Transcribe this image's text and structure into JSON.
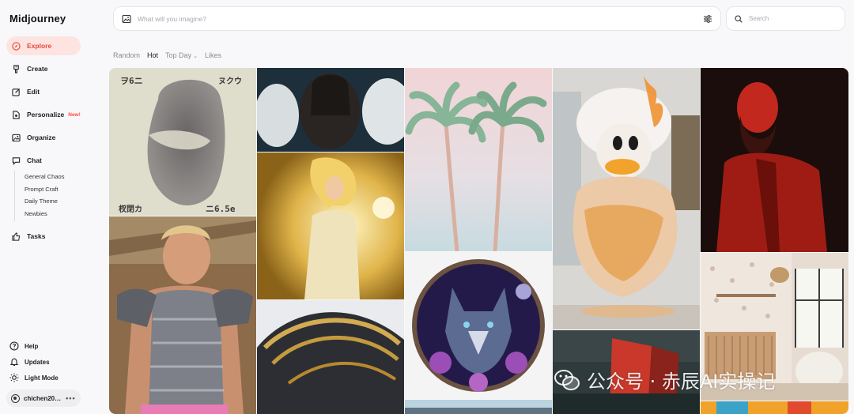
{
  "app": {
    "title": "Midjourney"
  },
  "sidebar": {
    "items": [
      {
        "label": "Explore",
        "icon": "compass-icon"
      },
      {
        "label": "Create",
        "icon": "brush-icon"
      },
      {
        "label": "Edit",
        "icon": "edit-icon"
      },
      {
        "label": "Personalize",
        "icon": "personalize-icon",
        "badge": "New!"
      },
      {
        "label": "Organize",
        "icon": "image-icon"
      },
      {
        "label": "Chat",
        "icon": "chat-icon"
      }
    ],
    "chat_rooms": [
      "General Chaos",
      "Prompt Craft",
      "Daily Theme",
      "Newbies"
    ],
    "tasks_label": "Tasks",
    "bottom": {
      "help": "Help",
      "updates": "Updates",
      "light_mode": "Light Mode"
    },
    "user": {
      "name": "chichen20…",
      "more": "•••"
    }
  },
  "imagine": {
    "placeholder": "What will you imagine?"
  },
  "search": {
    "placeholder": "Search"
  },
  "filters": {
    "random": "Random",
    "hot": "Hot",
    "top_day": "Top Day",
    "likes": "Likes",
    "active": "Hot"
  },
  "tiles": {
    "tile1_top_left": "ヲ6ニ",
    "tile1_top_right": "ヌクウ",
    "tile1_bottom_left": "杈閉カ",
    "tile1_bottom_right": "ニ6.5e"
  },
  "watermark": {
    "text": "公众号 · 赤辰AI实操记"
  },
  "colors": {
    "accent": "#e5483c",
    "active_bg": "#fde4e1",
    "badge": "#ff4a3d"
  }
}
